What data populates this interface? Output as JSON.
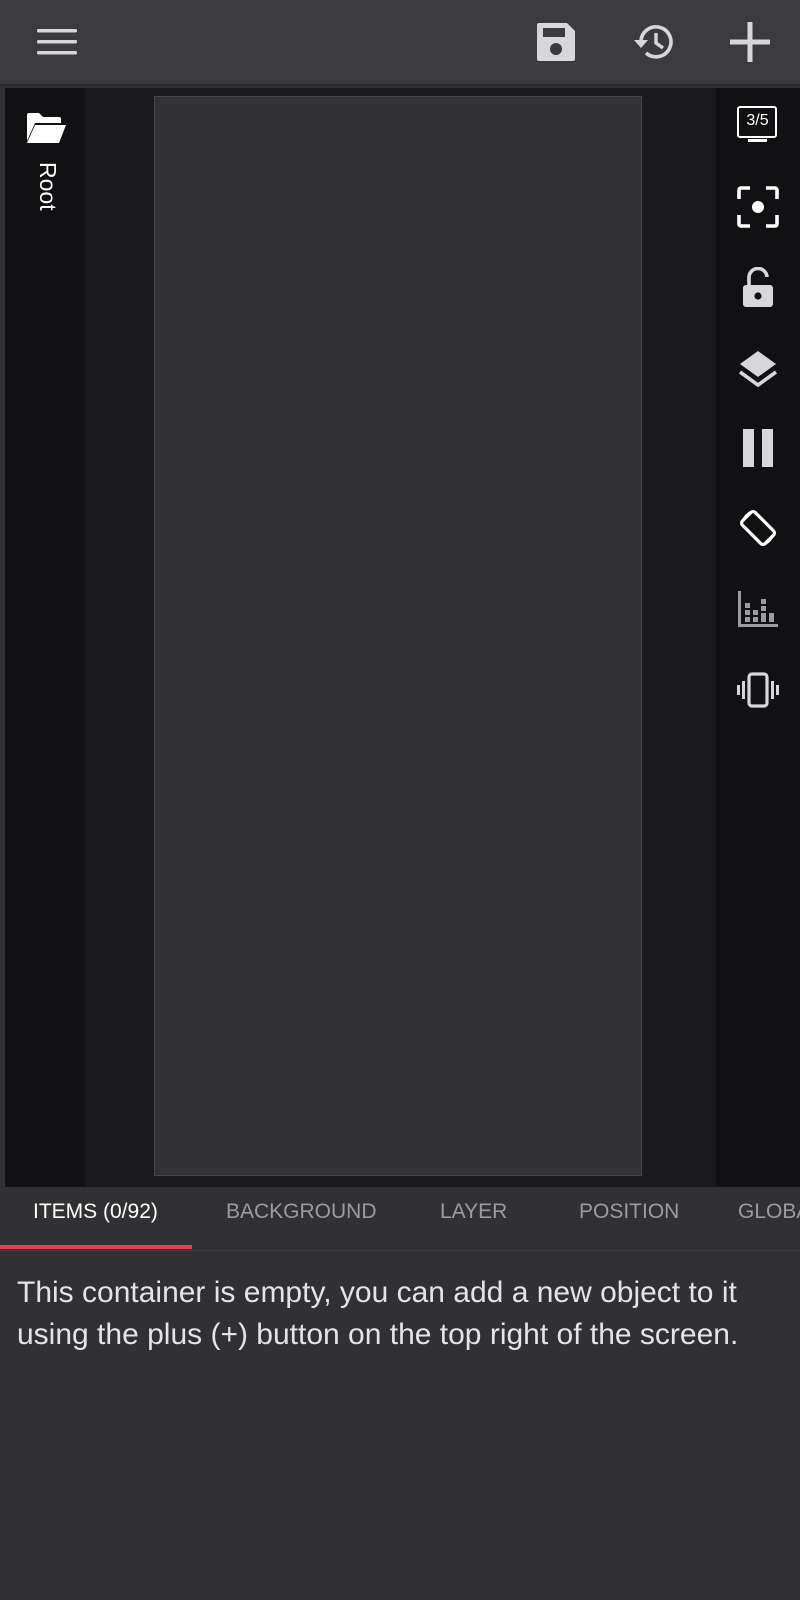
{
  "toolbar": {
    "menu_icon": "hamburger-menu-icon",
    "save_icon": "floppy-disk-icon",
    "history_icon": "history-clock-icon",
    "add_icon": "plus-icon"
  },
  "left_rail": {
    "folder_icon": "folder-open-icon",
    "root_label": "Root"
  },
  "right_rail": {
    "screen_counter": "3/5",
    "buttons": [
      "screen-counter-icon",
      "focus-target-icon",
      "lock-open-icon",
      "layers-icon",
      "pause-icon",
      "screen-rotation-icon",
      "equalizer-icon",
      "vibrate-icon"
    ]
  },
  "tabs": [
    {
      "label": "ITEMS (0/92)",
      "active": true
    },
    {
      "label": "BACKGROUND",
      "active": false
    },
    {
      "label": "LAYER",
      "active": false
    },
    {
      "label": "POSITION",
      "active": false
    },
    {
      "label": "GLOBA",
      "active": false
    }
  ],
  "message": "This container is empty, you can add a new object to it using the plus (+) button on the top right of the screen.",
  "colors": {
    "accent": "#e5414f",
    "toolbar_bg": "#3b3a3d",
    "panel_bg": "#313033",
    "rail_bg": "#111013",
    "icon": "#d7d6d9"
  }
}
